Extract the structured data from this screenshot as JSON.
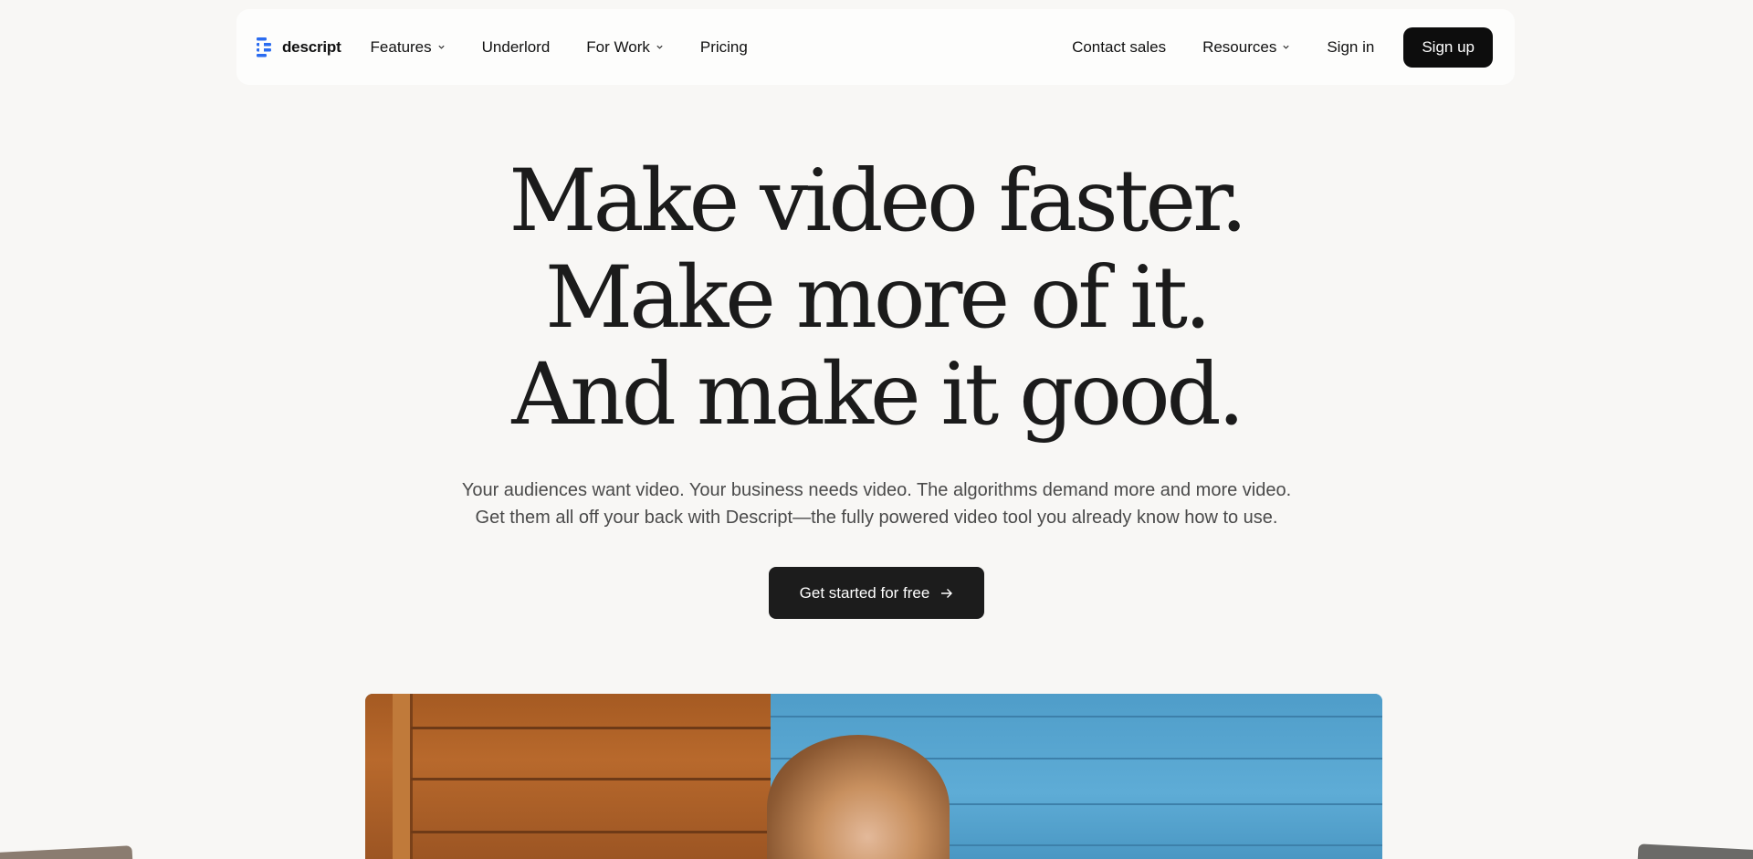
{
  "brand": {
    "name": "descript",
    "accent": "#2b6cf0"
  },
  "nav": {
    "left": [
      {
        "label": "Features",
        "dropdown": true
      },
      {
        "label": "Underlord",
        "dropdown": false
      },
      {
        "label": "For Work",
        "dropdown": true
      },
      {
        "label": "Pricing",
        "dropdown": false
      }
    ],
    "right": [
      {
        "label": "Contact sales",
        "dropdown": false
      },
      {
        "label": "Resources",
        "dropdown": true
      },
      {
        "label": "Sign in",
        "dropdown": false
      }
    ],
    "signup_label": "Sign up"
  },
  "hero": {
    "title_lines": [
      "Make video faster.",
      "Make more of it.",
      "And make it good."
    ],
    "subtitle_lines": [
      "Your audiences want video. Your business needs video. The algorithms demand more and more video.",
      "Get them all off your back with Descript—the fully powered video tool you already know how to use."
    ],
    "cta_label": "Get started for free",
    "cta_icon": "arrow-right-icon"
  }
}
